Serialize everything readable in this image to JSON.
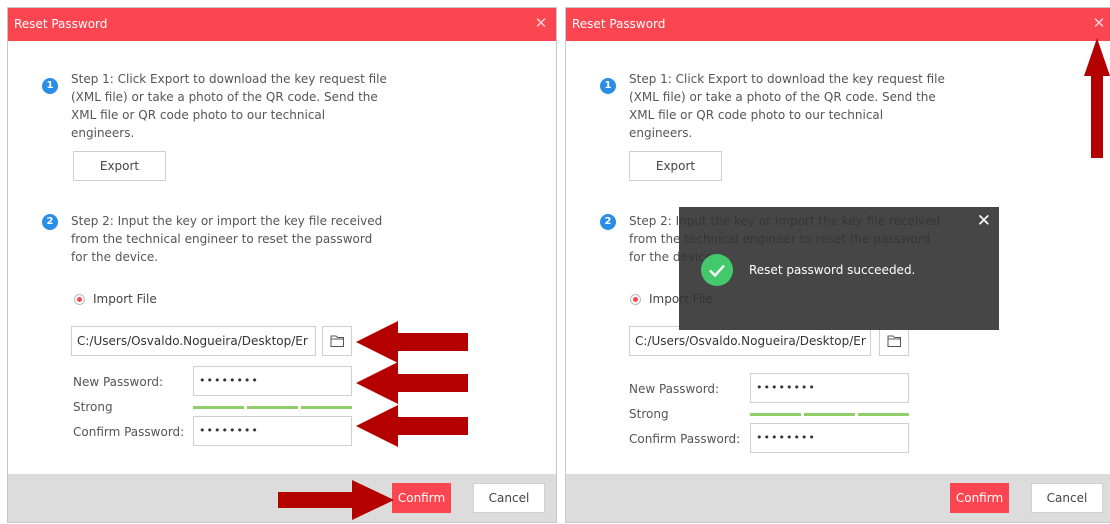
{
  "dialog_left": {
    "title": "Reset Password",
    "close_icon": "close-icon",
    "step1": {
      "number": "1",
      "text": "Step 1: Click Export to download the key request file (XML file) or take a photo of the QR code. Send the XML file or QR code photo to our technical engineers."
    },
    "export_label": "Export",
    "step2": {
      "number": "2",
      "text": "Step 2: Input the key or import the key file received from the technical engineer to reset the password for the device."
    },
    "import_file_label": "Import File",
    "file_path": "C:/Users/Osvaldo.Nogueira/Desktop/Er",
    "folder_icon": "folder-icon",
    "new_password_label": "New Password:",
    "new_password_value": "••••••••",
    "strength_label": "Strong",
    "confirm_password_label": "Confirm Password:",
    "confirm_password_value": "••••••••",
    "confirm_label": "Confirm",
    "cancel_label": "Cancel"
  },
  "dialog_right": {
    "title": "Reset Password",
    "close_icon": "close-icon",
    "step1": {
      "number": "1",
      "text": "Step 1: Click Export to download the key request file (XML file) or take a photo of the QR code. Send the XML file or QR code photo to our technical engineers."
    },
    "export_label": "Export",
    "step2": {
      "number": "2",
      "text": "Step 2: Input the key or import the key file received from the technical engineer to reset the password for the device."
    },
    "import_file_label": "Import File",
    "file_path": "C:/Users/Osvaldo.Nogueira/Desktop/Er",
    "folder_icon": "folder-icon",
    "new_password_label": "New Password:",
    "new_password_value": "••••••••",
    "strength_label": "Strong",
    "confirm_password_label": "Confirm Password:",
    "confirm_password_value": "••••••••",
    "confirm_label": "Confirm",
    "cancel_label": "Cancel"
  },
  "toast": {
    "message": "Reset password succeeded.",
    "icon": "check-circle-icon",
    "close_icon": "close-icon"
  },
  "annotations": {
    "arrow_icon": "red-arrow-icon"
  },
  "colors": {
    "brand_red": "#fb4550",
    "step_blue": "#2a8ee6",
    "strength_green": "#8fce6b",
    "arrow_red": "#b50000",
    "success_green": "#43c96b"
  }
}
